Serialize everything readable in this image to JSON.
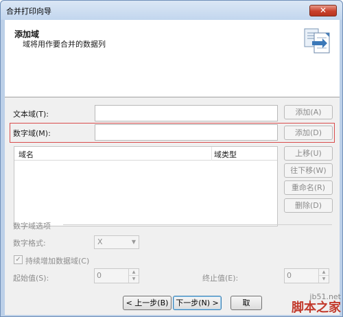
{
  "window": {
    "title": "合并打印向导",
    "close_glyph": "✕"
  },
  "header": {
    "title": "添加域",
    "subtitle": "域将用作要合并的数据列",
    "icon": "merge-document-icon"
  },
  "text_field": {
    "label": "文本域(T):",
    "value": "",
    "add_label": "添加(A)"
  },
  "number_field": {
    "label": "数字域(M):",
    "value": "",
    "add_label": "添加(D)"
  },
  "field_list": {
    "col_name": "域名",
    "col_type": "域类型",
    "rows": []
  },
  "side_buttons": {
    "up": "上移(U)",
    "down": "往下移(W)",
    "rename": "重命名(R)",
    "delete": "删除(D)"
  },
  "number_options": {
    "group_label": "数字域选项",
    "format_label": "数字格式:",
    "format_value": "X",
    "auto_increase_label": "持续增加数据域(C)",
    "auto_increase_checked": true,
    "start_label": "起始值(S):",
    "start_value": "0",
    "end_label": "终止值(E):",
    "end_value": "0"
  },
  "footer": {
    "prev": "< 上一步(B)",
    "next": "下一步(N) >",
    "cancel": "取"
  },
  "watermark": {
    "url": "jb51.net",
    "brand": "脚本之家"
  },
  "colors": {
    "highlight": "#d94a4a",
    "disabled_text": "#8d8d8d",
    "titlebar": "#c2d6ee"
  }
}
